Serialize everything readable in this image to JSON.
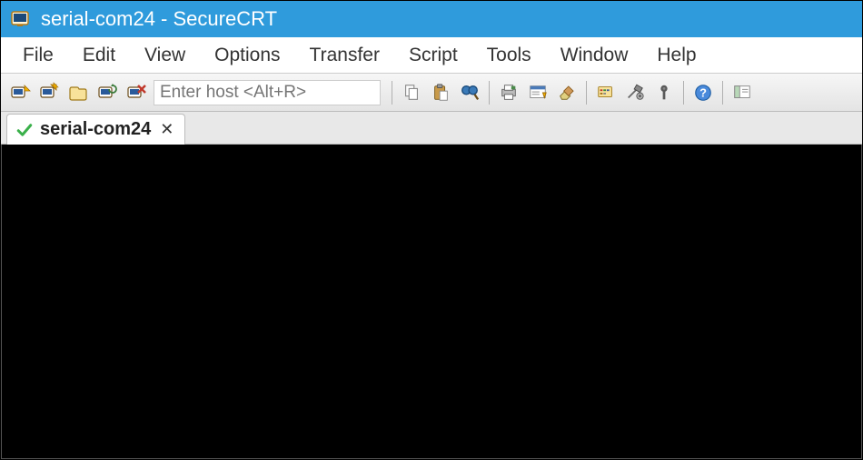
{
  "titlebar": {
    "title": "serial-com24 - SecureCRT"
  },
  "menubar": {
    "items": [
      "File",
      "Edit",
      "View",
      "Options",
      "Transfer",
      "Script",
      "Tools",
      "Window",
      "Help"
    ]
  },
  "toolbar": {
    "host_input_placeholder": "Enter host <Alt+R>",
    "host_input_value": ""
  },
  "tabs": [
    {
      "label": "serial-com24",
      "active": true
    }
  ],
  "colors": {
    "titlebar_bg": "#2f9bdc",
    "terminal_bg": "#000000"
  }
}
